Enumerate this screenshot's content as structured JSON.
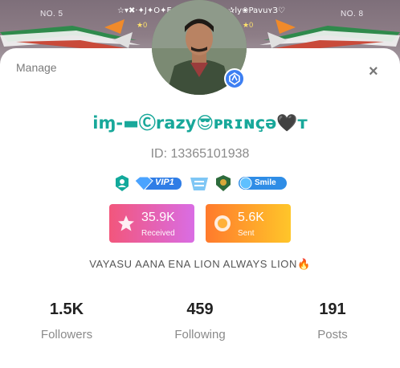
{
  "banner": {
    "rank_left": "NO. 5",
    "rank_right": "NO. 8",
    "name_left": "☆▾✖·✦J✦O✦E✦",
    "name_right": "✰ly❀PavuʏЗ♡",
    "count_left": "0",
    "count_right": "0"
  },
  "header": {
    "manage_label": "Manage",
    "close_symbol": "×"
  },
  "profile": {
    "nickname": "iɱ‑▬Ⓒrazy😎ᴘʀɪɴçə🖤ᴛ",
    "user_id": "ID: 13365101938",
    "bio": "VAYASU AANA ENA LION ALWAYS LION🔥"
  },
  "badges": {
    "vip_text": "VIP1",
    "smile_text": "Smile"
  },
  "gifts": {
    "received_value": "35.9K",
    "received_label": "Received",
    "sent_value": "5.6K",
    "sent_label": "Sent"
  },
  "stats": [
    {
      "value": "1.5K",
      "label": "Followers"
    },
    {
      "value": "459",
      "label": "Following"
    },
    {
      "value": "191",
      "label": "Posts"
    }
  ],
  "colors": {
    "accent_teal": "#18a89a",
    "received_start": "#f2567c",
    "received_end": "#d96de4",
    "sent_start": "#ff7a2c",
    "sent_end": "#ffc62a",
    "verify_blue": "#3d7ff2"
  }
}
